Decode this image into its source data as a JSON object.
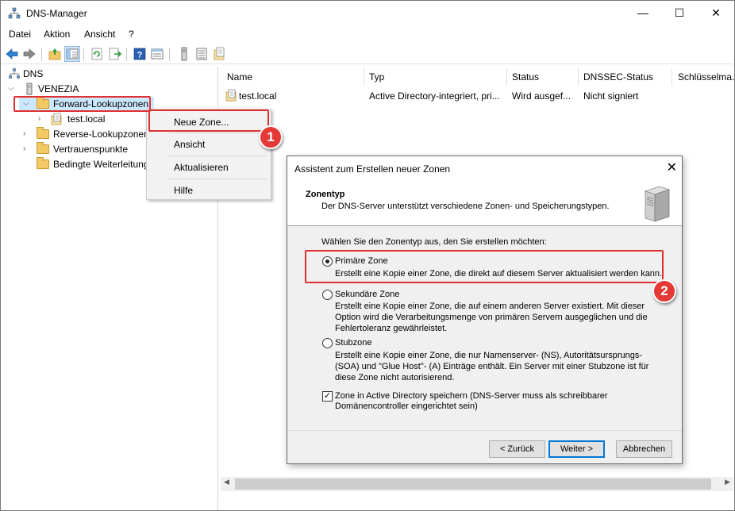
{
  "window": {
    "title": "DNS-Manager",
    "controls": {
      "minimize": "—",
      "maximize": "☐",
      "close": "✕"
    }
  },
  "menubar": [
    "Datei",
    "Aktion",
    "Ansicht",
    "?"
  ],
  "tree": {
    "root": "DNS",
    "server": "VENEZIA",
    "items": {
      "forward": "Forward-Lookupzonen",
      "test_local": "test.local",
      "reverse": "Reverse-Lookupzonen",
      "trust": "Vertrauenspunkte",
      "conditional": "Bedingte Weiterleitung"
    }
  },
  "list": {
    "columns": [
      "Name",
      "Typ",
      "Status",
      "DNSSEC-Status",
      "Schlüsselma..."
    ],
    "rows": [
      [
        "test.local",
        "Active Directory-integriert, pri...",
        "Wird ausgef...",
        "Nicht signiert",
        ""
      ]
    ]
  },
  "context_menu": {
    "items": [
      "Neue Zone...",
      "Ansicht",
      "Aktualisieren",
      "Hilfe"
    ]
  },
  "badges": [
    "1",
    "2"
  ],
  "wizard": {
    "title": "Assistent zum Erstellen neuer Zonen",
    "close": "✕",
    "heading": "Zonentyp",
    "subheading": "Der DNS-Server unterstützt verschiedene Zonen- und Speicherungstypen.",
    "prompt": "Wählen Sie den Zonentyp aus, den Sie erstellen möchten:",
    "options": [
      {
        "label": "Primäre Zone",
        "desc": [
          "Erstellt eine Kopie einer Zone, die direkt auf diesem Server aktualisiert werden kann."
        ],
        "selected": true
      },
      {
        "label": "Sekundäre Zone",
        "desc": [
          "Erstellt eine Kopie einer Zone, die auf einem anderen Server existiert. Mit dieser",
          "Option wird die Verarbeitungsmenge von primären Servern ausgeglichen und die",
          "Fehlertoleranz gewährleistet."
        ],
        "selected": false
      },
      {
        "label": "Stubzone",
        "desc": [
          "Erstellt eine Kopie einer Zone, die nur Namenserver- (NS), Autoritätsursprungs-",
          "(SOA) und \"Glue Host\"- (A) Einträge enthält. Ein Server mit einer Stubzone ist für",
          "diese Zone nicht autorisierend."
        ],
        "selected": false
      }
    ],
    "ad_checkbox": {
      "checked": true,
      "lines": [
        "Zone in Active Directory speichern (DNS-Server muss als schreibbarer",
        "Domänencontroller eingerichtet sein)"
      ]
    },
    "buttons": {
      "back": "< Zurück",
      "next": "Weiter >",
      "cancel": "Abbrechen"
    }
  },
  "colors": {
    "annotation": "#e03131",
    "badge": "#e53935",
    "folder": "#f3c965",
    "accent": "#0078d7"
  }
}
